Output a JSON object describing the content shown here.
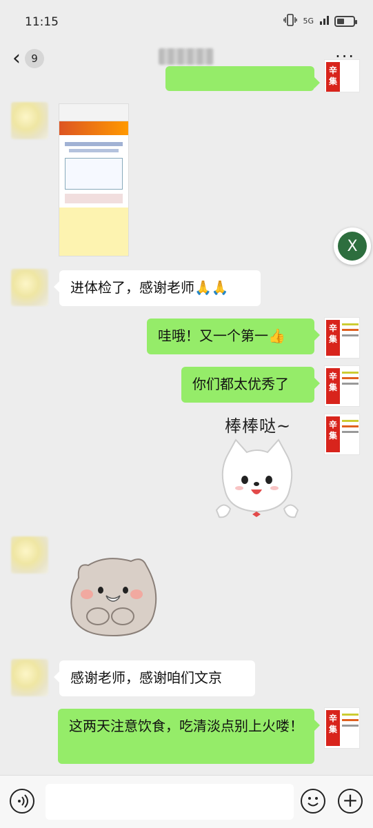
{
  "status_bar": {
    "time": "11:15",
    "network": "5G",
    "battery_level": 0.45
  },
  "nav": {
    "back_label": "‹",
    "unread_count": "9",
    "more_label": "···"
  },
  "avatar_badge": {
    "line1": "辛",
    "line2": "集"
  },
  "sticker_caption": "棒棒哒~",
  "fab_label": "X",
  "messages": [
    {
      "side": "left",
      "type": "image",
      "text": ""
    },
    {
      "side": "left",
      "type": "text",
      "text": "进体检了，感谢老师🙏🙏"
    },
    {
      "side": "right",
      "type": "text",
      "text": "哇哦！又一个第一👍"
    },
    {
      "side": "right",
      "type": "text",
      "text": "你们都太优秀了"
    },
    {
      "side": "right",
      "type": "sticker",
      "text": ""
    },
    {
      "side": "left",
      "type": "sticker",
      "text": ""
    },
    {
      "side": "left",
      "type": "text",
      "text": "感谢老师，感谢咱们文京"
    },
    {
      "side": "right",
      "type": "text",
      "text": "这两天注意饮食，吃清淡点别上火喽！"
    }
  ],
  "input": {
    "placeholder": ""
  },
  "colors": {
    "background": "#ededed",
    "bubble_right": "#95ec69",
    "bubble_left": "#ffffff",
    "fab": "#2d6e3e"
  }
}
